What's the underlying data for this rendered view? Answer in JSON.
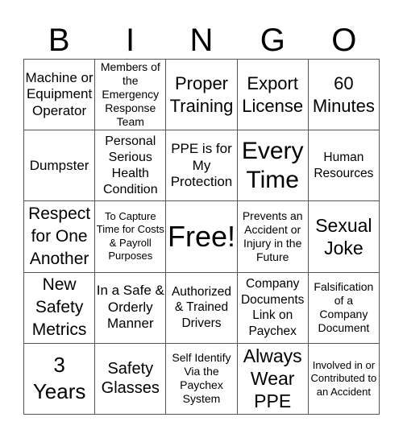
{
  "header": {
    "letters": [
      "B",
      "I",
      "N",
      "G",
      "O"
    ]
  },
  "board": {
    "cells": [
      [
        "Machine or Equipment Operator",
        "Members of the Emergency Response Team",
        "Proper Training",
        "Export License",
        "60 Minutes"
      ],
      [
        "Dumpster",
        "Personal Serious Health Condition",
        "PPE is for My Protection",
        "Every Time",
        "Human Resources"
      ],
      [
        "Respect for One Another",
        "To Capture Time for Costs & Payroll Purposes",
        "Free!",
        "Prevents an Accident or Injury in the Future",
        "Sexual Joke"
      ],
      [
        "New Safety Metrics",
        "In a Safe & Orderly Manner",
        "Authorized & Trained Drivers",
        "Company Documents Link on Paychex",
        "Falsification of a Company Document"
      ],
      [
        "3 Years",
        "Safety Glasses",
        "Self Identify Via the Paychex System",
        "Always Wear PPE",
        "Involved in or Contributed to an Accident"
      ]
    ],
    "free_space": "Free!"
  }
}
